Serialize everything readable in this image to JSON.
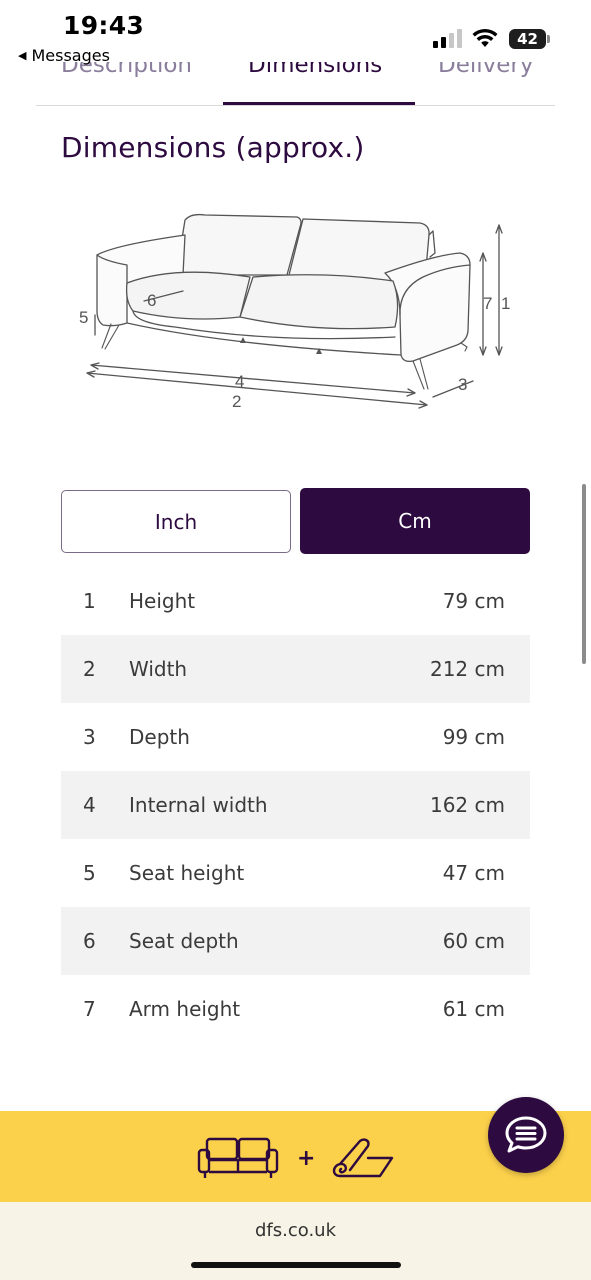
{
  "status_bar": {
    "time": "19:43",
    "back_label": "Messages",
    "back_icon": "back-triangle-icon",
    "battery_level": "42",
    "signal_bars_on": 2,
    "signal_bars_total": 4
  },
  "tabs": [
    {
      "label": "Description",
      "active": false
    },
    {
      "label": "Dimensions",
      "active": true
    },
    {
      "label": "Delivery",
      "active": false
    }
  ],
  "section_title": "Dimensions (approx.)",
  "diagram": {
    "callouts": [
      "1",
      "2",
      "3",
      "4",
      "5",
      "6",
      "7"
    ]
  },
  "unit_toggle": {
    "inch_label": "Inch",
    "cm_label": "Cm",
    "selected": "Cm"
  },
  "dimensions": [
    {
      "num": "1",
      "label": "Height",
      "value": "79 cm"
    },
    {
      "num": "2",
      "label": "Width",
      "value": "212 cm"
    },
    {
      "num": "3",
      "label": "Depth",
      "value": "99 cm"
    },
    {
      "num": "4",
      "label": "Internal width",
      "value": "162 cm"
    },
    {
      "num": "5",
      "label": "Seat height",
      "value": "47 cm"
    },
    {
      "num": "6",
      "label": "Seat depth",
      "value": "60 cm"
    },
    {
      "num": "7",
      "label": "Arm height",
      "value": "61 cm"
    }
  ],
  "promo": {
    "plus": "+",
    "icons": [
      "sofa-icon",
      "rug-icon"
    ]
  },
  "chat_icon": "chat-bubble-icon",
  "browser": {
    "url": "dfs.co.uk"
  },
  "colors": {
    "brand_purple": "#2d0a3f",
    "promo_yellow": "#fbd04b",
    "row_alt": "#f2f2f2"
  }
}
